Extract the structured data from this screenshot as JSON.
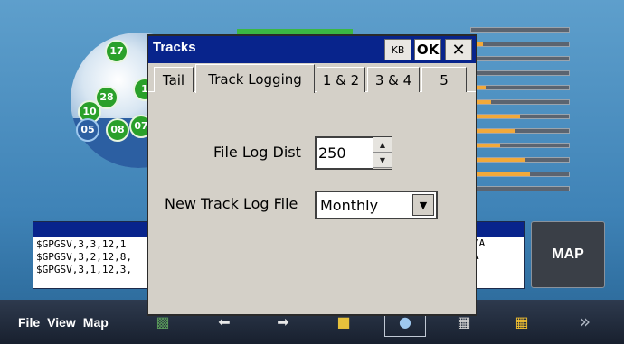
{
  "background": {
    "satellites": [
      "17",
      "28",
      "10",
      "05",
      "08",
      "07",
      "1"
    ],
    "nmea_lines": [
      "$GPGSV,3,3,12,1",
      "$GPGSV,3,2,12,8,",
      "$GPGSV,3,1,12,3,"
    ],
    "nmea_right": [
      "7A",
      "A"
    ],
    "map_label": "MAP",
    "bar_levels": [
      0,
      0.12,
      0,
      0,
      0.15,
      0.2,
      0.5,
      0.45,
      0.3,
      0.55,
      0.6,
      0
    ]
  },
  "menubar": {
    "file": "File",
    "view": "View",
    "map": "Map"
  },
  "dialog": {
    "title": "Tracks",
    "kb_label": "KB",
    "ok_label": "OK",
    "close_label": "✕",
    "tabs": [
      "Tail",
      "Track Logging",
      "1 & 2",
      "3 & 4",
      "5"
    ],
    "active_tab": "Track Logging",
    "file_log_dist_label": "File Log Dist",
    "file_log_dist_value": "250",
    "new_track_log_label": "New Track Log File",
    "new_track_log_value": "Monthly"
  },
  "colors": {
    "titlebar": "#08248c",
    "dialog_bg": "#d4d0c8",
    "signal_bar": "#f2a93a",
    "satellite": "#2aa02a"
  }
}
